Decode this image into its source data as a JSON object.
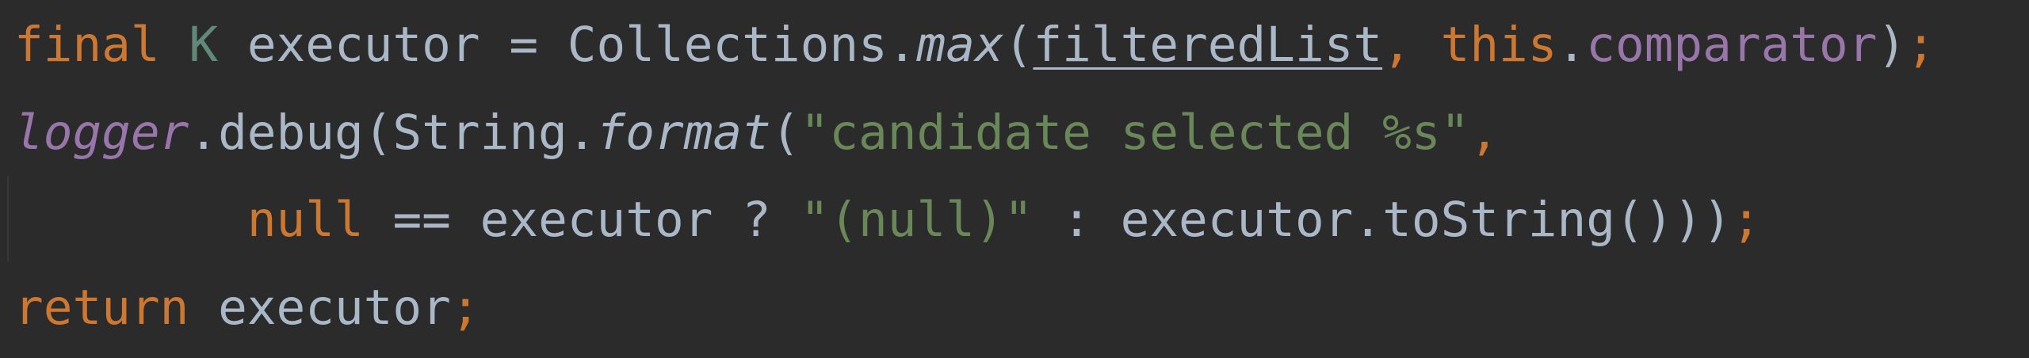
{
  "editor": {
    "lines": [
      {
        "tokens": [
          {
            "text": "final",
            "kind": "keyword"
          },
          {
            "text": " ",
            "kind": "space"
          },
          {
            "text": "K",
            "kind": "type-parameter"
          },
          {
            "text": " executor = Collections.",
            "kind": "plain"
          },
          {
            "text": "max",
            "kind": "static-method"
          },
          {
            "text": "(",
            "kind": "plain"
          },
          {
            "text": "filteredList",
            "kind": "local-variable"
          },
          {
            "text": ", ",
            "kind": "punctuation"
          },
          {
            "text": "this",
            "kind": "keyword"
          },
          {
            "text": ".",
            "kind": "plain"
          },
          {
            "text": "comparator",
            "kind": "field"
          },
          {
            "text": ")",
            "kind": "plain"
          },
          {
            "text": ";",
            "kind": "punctuation"
          }
        ]
      },
      {
        "tokens": [
          {
            "text": "logger",
            "kind": "static-field"
          },
          {
            "text": ".debug(String.",
            "kind": "plain"
          },
          {
            "text": "format",
            "kind": "static-method"
          },
          {
            "text": "(",
            "kind": "plain"
          },
          {
            "text": "\"candidate selected %s\"",
            "kind": "string"
          },
          {
            "text": ",",
            "kind": "punctuation"
          }
        ]
      },
      {
        "tokens": [
          {
            "text": "        ",
            "kind": "space"
          },
          {
            "text": "null",
            "kind": "keyword"
          },
          {
            "text": " == executor ? ",
            "kind": "plain"
          },
          {
            "text": "\"(null)\"",
            "kind": "string"
          },
          {
            "text": " : executor.toString()))",
            "kind": "plain"
          },
          {
            "text": ";",
            "kind": "punctuation"
          }
        ]
      },
      {
        "tokens": [
          {
            "text": "return",
            "kind": "keyword"
          },
          {
            "text": " executor",
            "kind": "plain"
          },
          {
            "text": ";",
            "kind": "punctuation"
          }
        ]
      }
    ]
  },
  "colors": {
    "background": "#2b2b2b",
    "keyword": "#cc7832",
    "type_parameter": "#5f8a79",
    "plain": "#a9b7c6",
    "field": "#9876aa",
    "string": "#6a8759"
  }
}
